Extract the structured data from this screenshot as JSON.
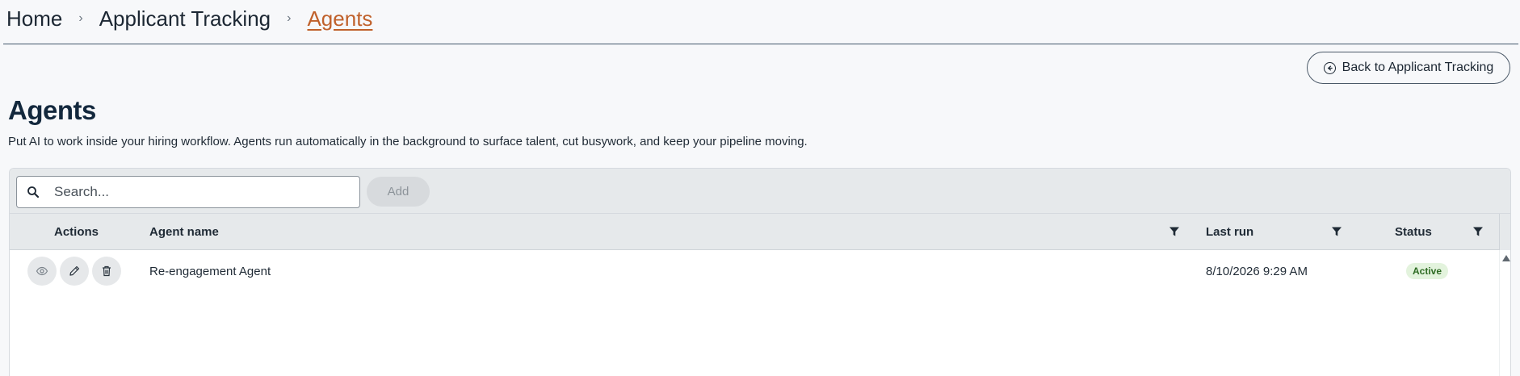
{
  "breadcrumb": {
    "items": [
      "Home",
      "Applicant Tracking",
      "Agents"
    ],
    "separator": "›"
  },
  "back_button": {
    "label": "Back to Applicant Tracking",
    "icon": "circle-arrow-left-icon"
  },
  "page": {
    "title": "Agents",
    "description": "Put AI to work inside your hiring workflow. Agents run automatically in the background to surface talent, cut busywork, and keep your pipeline moving."
  },
  "toolbar": {
    "search_placeholder": "Search...",
    "add_label": "Add"
  },
  "table": {
    "columns": [
      "Actions",
      "Agent name",
      "Last run",
      "Status"
    ],
    "rows": [
      {
        "actions": [
          "view-icon",
          "edit-icon",
          "delete-icon"
        ],
        "agent_name": "Re-engagement Agent",
        "last_run": "8/10/2026 9:29 AM",
        "status": "Active"
      }
    ]
  },
  "colors": {
    "accent_breadcrumb": "#c0612b",
    "title": "#13283d",
    "status_active_bg": "#e3f3dd",
    "status_active_text": "#2e6b23"
  }
}
